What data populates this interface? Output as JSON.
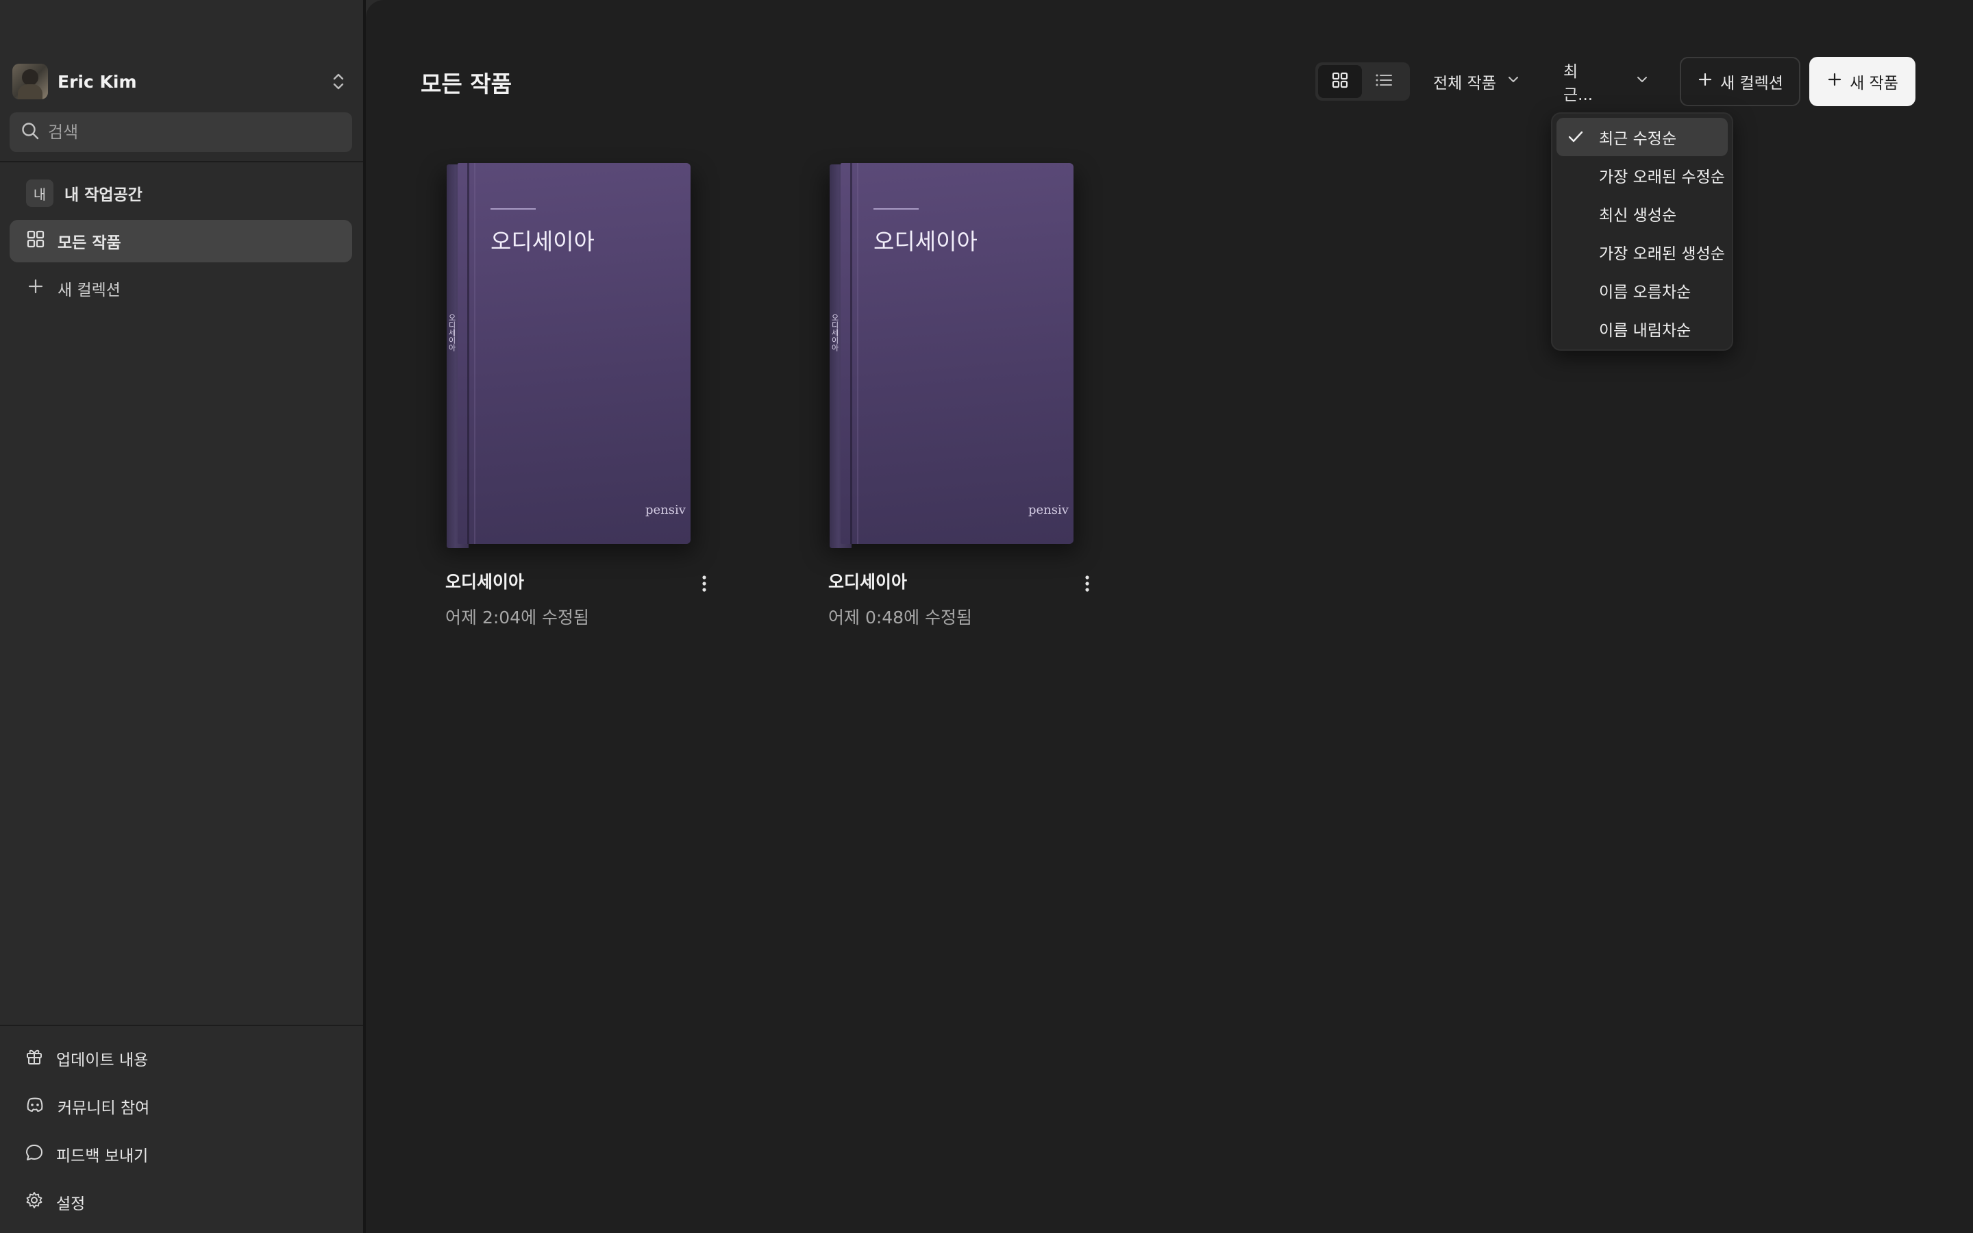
{
  "user": {
    "name": "Eric Kim"
  },
  "search": {
    "placeholder": "검색"
  },
  "sidebar": {
    "workspace": {
      "badge": "내",
      "label": "내 작업공간"
    },
    "items": [
      {
        "label": "모든 작품",
        "icon": "grid-icon",
        "active": true
      },
      {
        "label": "새 컬렉션",
        "icon": "plus-icon",
        "active": false
      }
    ],
    "footer": [
      {
        "label": "업데이트 내용",
        "icon": "gift-icon"
      },
      {
        "label": "커뮤니티 참여",
        "icon": "discord-icon"
      },
      {
        "label": "피드백 보내기",
        "icon": "chat-bubble-icon"
      },
      {
        "label": "설정",
        "icon": "gear-icon"
      }
    ]
  },
  "header": {
    "title": "모든 작품",
    "filter": "전체 작품",
    "sort": "최근...",
    "new_collection": "새 컬렉션",
    "new_work": "새 작품"
  },
  "sort_menu": {
    "items": [
      {
        "label": "최근 수정순",
        "selected": true
      },
      {
        "label": "가장 오래된 수정순",
        "selected": false
      },
      {
        "label": "최신 생성순",
        "selected": false
      },
      {
        "label": "가장 오래된 생성순",
        "selected": false
      },
      {
        "label": "이름 오름차순",
        "selected": false
      },
      {
        "label": "이름 내림차순",
        "selected": false
      }
    ]
  },
  "works": [
    {
      "title": "오디세이아",
      "cover_title": "오디세이아",
      "publisher": "pensiv",
      "spine": "오디세이아",
      "modified": "어제 2:04에 수정됨"
    },
    {
      "title": "오디세이아",
      "cover_title": "오디세이아",
      "publisher": "pensiv",
      "spine": "오디세이아",
      "modified": "어제 0:48에 수정됨"
    }
  ],
  "colors": {
    "background": "#1f1f1f",
    "sidebar": "#2b2b2b",
    "book_cover": "#4b3d66",
    "primary_button": "#f4f4f4"
  }
}
